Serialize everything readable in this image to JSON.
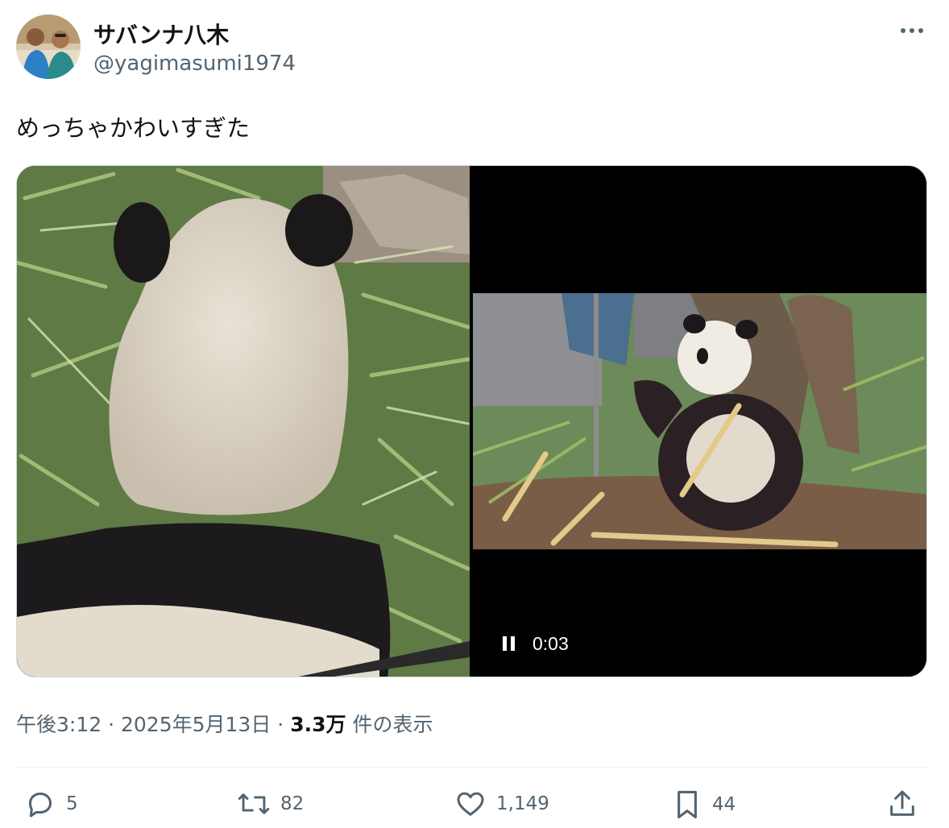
{
  "author": {
    "display_name": "サバンナ八木",
    "handle": "@yagimasumi1974"
  },
  "tweet": {
    "text": "めっちゃかわいすぎた"
  },
  "media": {
    "video_duration": "0:03"
  },
  "meta": {
    "time": "午後3:12",
    "date": "2025年5月13日",
    "views_count": "3.3万",
    "views_label": "件の表示",
    "separator": "·"
  },
  "actions": {
    "replies": "5",
    "reposts": "82",
    "likes": "1,149",
    "bookmarks": "44"
  },
  "icons": {
    "more": "more-icon",
    "reply": "reply-icon",
    "repost": "repost-icon",
    "like": "heart-icon",
    "bookmark": "bookmark-icon",
    "share": "share-icon",
    "pause": "pause-icon"
  },
  "colors": {
    "text": "#0f1419",
    "secondary": "#536471",
    "border": "#cfd9de"
  }
}
